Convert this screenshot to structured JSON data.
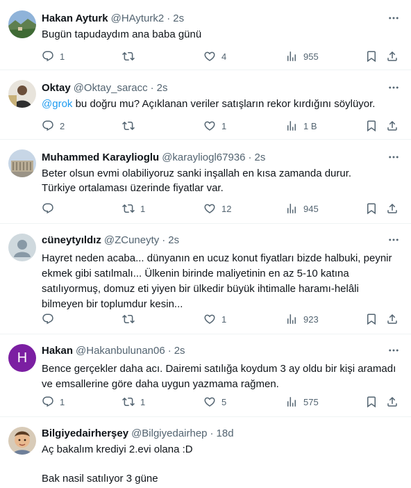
{
  "tweets": [
    {
      "name": "Hakan Ayturk",
      "handle": "@HAyturk2",
      "time": "2s",
      "text": "Bugün tapudaydım ana baba günü",
      "replies": "1",
      "retweets": "",
      "likes": "4",
      "views": "955",
      "avatar": "landscape-photo"
    },
    {
      "name": "Oktay",
      "handle": "@Oktay_saracc",
      "time": "2s",
      "mention": "@grok",
      "text": " bu doğru mu? Açıklanan veriler satışların rekor kırdığını söylüyor.",
      "replies": "2",
      "retweets": "",
      "likes": "1",
      "views": "1 B",
      "avatar": "person-photo"
    },
    {
      "name": "Muhammed Karaylioglu",
      "handle": "@karayliogl67936",
      "time": "2s",
      "text": "Beter olsun evmi olabiliyoruz sanki inşallah en kısa zamanda durur.\nTürkiye ortalaması üzerinde fiyatlar var.",
      "replies": "",
      "retweets": "1",
      "likes": "12",
      "views": "945",
      "avatar": "monument-photo"
    },
    {
      "name": "cüneytyıldız",
      "handle": "@ZCuneyty",
      "time": "2s",
      "text": "Hayret neden acaba... dünyanın en ucuz konut fiyatları bizde halbuki, peynir\nekmek gibi satılmalı... Ülkenin birinde maliyetinin en az 5-10 katına\nsatılıyormuş, domuz eti yiyen bir ülkedir büyük ihtimalle haramı-helâli\nbilmeyen bir toplumdur kesin...",
      "replies": "",
      "retweets": "",
      "likes": "1",
      "views": "923",
      "avatar": "default-avatar"
    },
    {
      "name": "Hakan",
      "handle": "@Hakanbulunan06",
      "time": "2s",
      "text": "Bence gerçekler daha acı. Dairemi satılığa koydum 3 ay oldu bir kişi aramadı\nve emsallerine göre daha uygun yazmama rağmen.",
      "replies": "1",
      "retweets": "1",
      "likes": "5",
      "views": "575",
      "avatar": "letter-avatar",
      "avatar_letter": "H",
      "avatar_color": "#7b1fa2"
    },
    {
      "name": "Bilgiyedairherşey",
      "handle": "@Bilgiyedairhep",
      "time": "18d",
      "text": "Aç bakalım krediyi 2.evi olana :D\n\nBak nasil satılıyor 3 güne",
      "avatar": "child-photo"
    }
  ],
  "colors": {
    "text": "#0f1419",
    "secondary": "#536471",
    "link": "#1d9bf0",
    "divider": "#eff3f4"
  },
  "icons": [
    "reply-icon",
    "retweet-icon",
    "like-icon",
    "views-icon",
    "bookmark-icon",
    "share-icon",
    "more-icon"
  ]
}
